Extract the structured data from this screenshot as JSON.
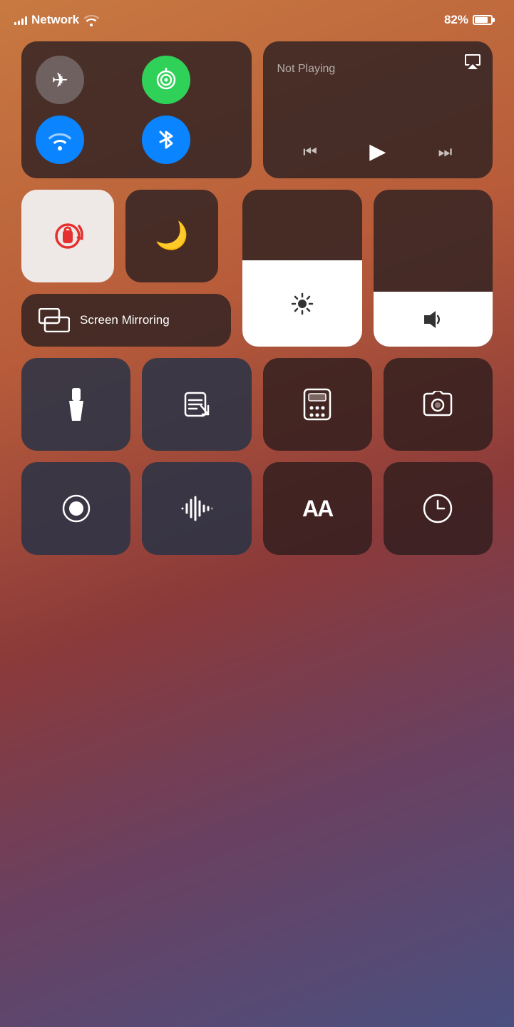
{
  "status": {
    "carrier": "Network",
    "battery_percent": "82%",
    "battery_level": 82
  },
  "network_block": {
    "airplane_icon": "✈",
    "cellular_icon": "📡",
    "wifi_icon": "wifi",
    "bluetooth_icon": "bluetooth"
  },
  "now_playing": {
    "label": "Not Playing",
    "airplay_icon": "airplay"
  },
  "controls": {
    "lock_rotation_label": "Lock Rotation",
    "moon_label": "Do Not Disturb",
    "brightness_label": "Brightness",
    "volume_label": "Volume",
    "screen_mirroring_label": "Screen\nMirroring",
    "flashlight_label": "Flashlight",
    "notes_label": "Notes",
    "calculator_label": "Calculator",
    "camera_label": "Camera",
    "screen_record_label": "Screen Record",
    "voice_memos_label": "Voice Memos",
    "text_size_label": "Text Size",
    "clock_label": "Clock"
  }
}
